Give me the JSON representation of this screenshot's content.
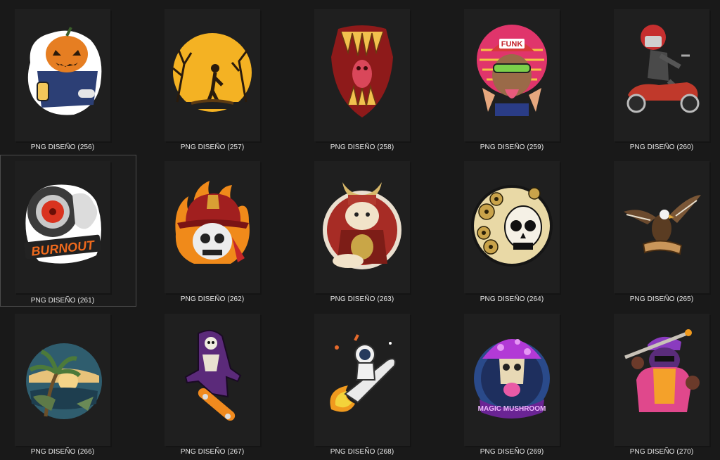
{
  "files": [
    {
      "label": "PNG DISEÑO (256)",
      "icon": "pumpkin-lantern-icon",
      "selected": false
    },
    {
      "label": "PNG DISEÑO (257)",
      "icon": "zombie-moon-icon",
      "selected": false
    },
    {
      "label": "PNG DISEÑO (258)",
      "icon": "monster-mouth-icon",
      "selected": false
    },
    {
      "label": "PNG DISEÑO (259)",
      "icon": "funk-monkey-icon",
      "selected": false
    },
    {
      "label": "PNG DISEÑO (260)",
      "icon": "skeleton-scooter-icon",
      "selected": false
    },
    {
      "label": "PNG DISEÑO (261)",
      "icon": "burnout-wheel-icon",
      "selected": true
    },
    {
      "label": "PNG DISEÑO (262)",
      "icon": "firefighter-skull-icon",
      "selected": false
    },
    {
      "label": "PNG DISEÑO (263)",
      "icon": "samurai-cat-icon",
      "selected": false
    },
    {
      "label": "PNG DISEÑO (264)",
      "icon": "floral-skull-icon",
      "selected": false
    },
    {
      "label": "PNG DISEÑO (265)",
      "icon": "eagle-banner-icon",
      "selected": false
    },
    {
      "label": "PNG DISEÑO (266)",
      "icon": "tropical-beach-icon",
      "selected": false
    },
    {
      "label": "PNG DISEÑO (267)",
      "icon": "reaper-skateboard-icon",
      "selected": false
    },
    {
      "label": "PNG DISEÑO (268)",
      "icon": "astronaut-rocket-icon",
      "selected": false
    },
    {
      "label": "PNG DISEÑO (269)",
      "icon": "magic-mushroom-icon",
      "selected": false
    },
    {
      "label": "PNG DISEÑO (270)",
      "icon": "gorilla-bat-icon",
      "selected": false
    }
  ],
  "artwork_text": {
    "funk": "FUNK",
    "burnout": "BURNOUT",
    "magic_mushroom": "MAGIC MUSHROOM"
  },
  "colors": {
    "background": "#191919",
    "thumbnail": "#1f1f1f",
    "label": "#e8e8e8",
    "selection_border": "#4c4c4c"
  }
}
